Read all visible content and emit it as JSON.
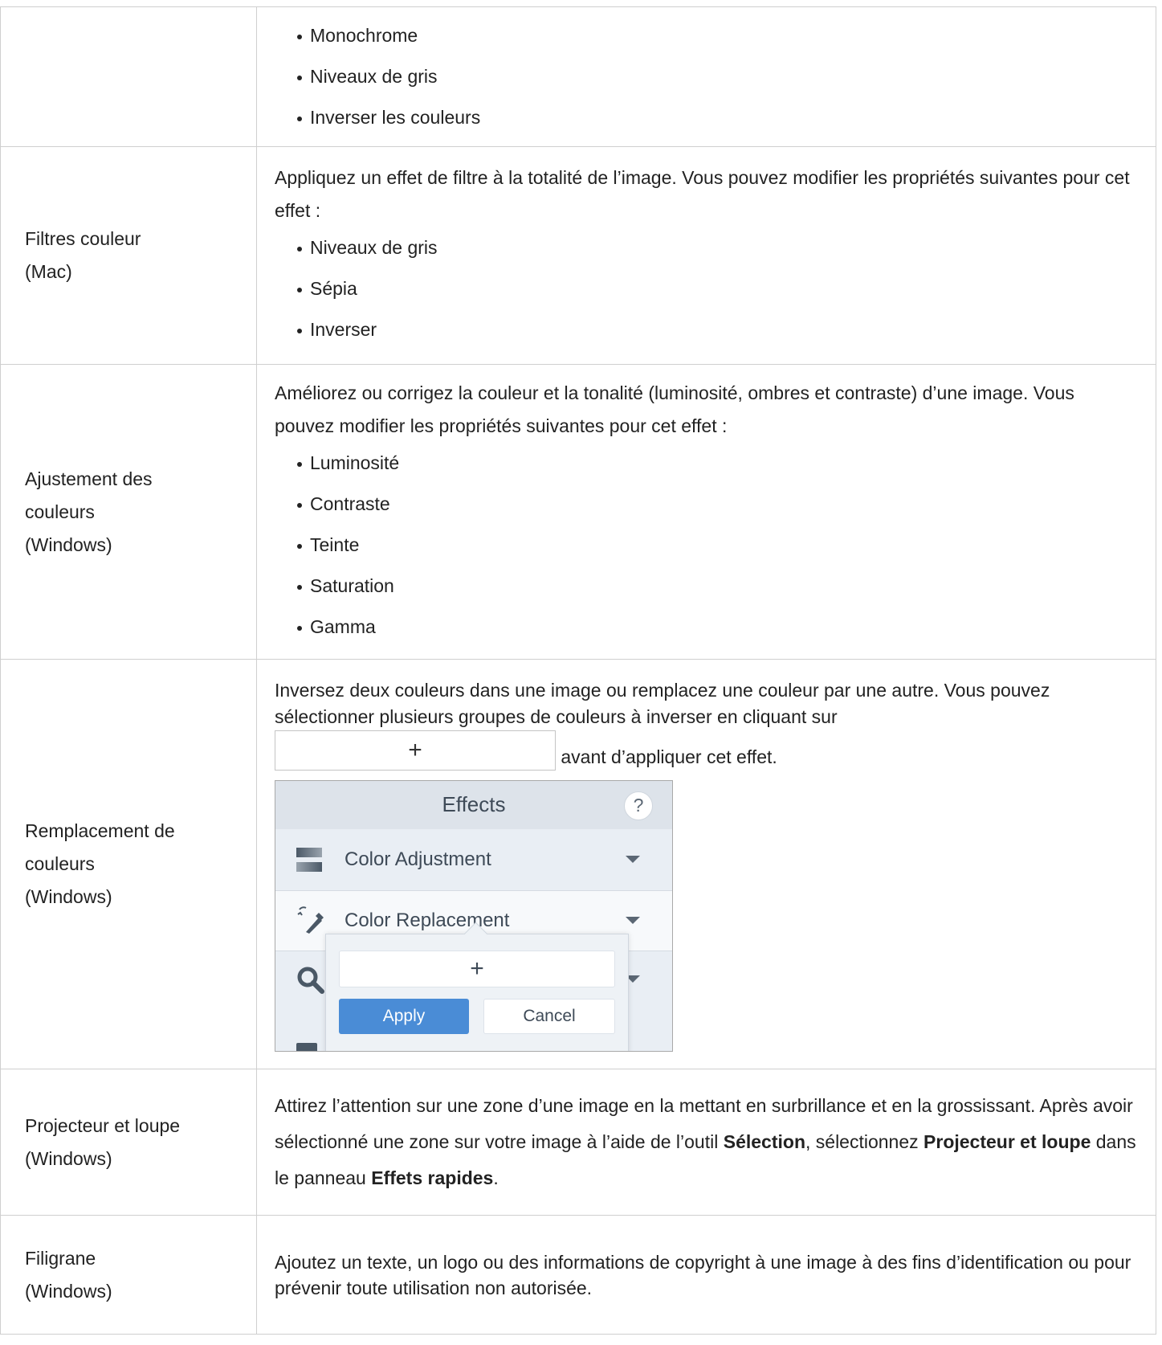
{
  "rows": [
    {
      "name": "",
      "bullets": [
        "Monochrome",
        "Niveaux de gris",
        "Inverser les couleurs"
      ]
    },
    {
      "name_line1": "Filtres couleur",
      "name_line2": "(Mac)",
      "desc": "Appliquez un effet de filtre à la totalité de l’image. Vous pouvez modifier les propriétés suivantes pour cet effet :",
      "bullets": [
        "Niveaux de gris",
        "Sépia",
        "Inverser"
      ]
    },
    {
      "name_line1": "Ajustement des",
      "name_line2": "couleurs",
      "name_line3": "(Windows)",
      "desc": "Améliorez ou corrigez la couleur et la tonalité (luminosité, ombres et contraste) d’une image. Vous pouvez modifier les propriétés suivantes pour cet effet :",
      "bullets": [
        "Luminosité",
        "Contraste",
        "Teinte",
        "Saturation",
        "Gamma"
      ]
    },
    {
      "name_line1": "Remplacement de",
      "name_line2": "couleurs",
      "name_line3": "(Windows)",
      "desc_before": "Inversez deux couleurs dans une image ou remplacez une couleur par une autre. Vous pouvez sélectionner plusieurs groupes de couleurs à inverser en cliquant sur",
      "inline_button": "+",
      "desc_after": "avant d’appliquer cet effet.",
      "panel": {
        "title": "Effects",
        "help": "?",
        "item1": "Color Adjustment",
        "item2": "Color Replacement",
        "popup_plus": "+",
        "apply": "Apply",
        "cancel": "Cancel",
        "accent": "#4a8cd6"
      }
    },
    {
      "name_line1": "Projecteur et loupe",
      "name_line2": "(Windows)",
      "desc_1": "Attirez l’attention sur une zone d’une image en la mettant en surbrillance et en la grossissant. Après avoir sélectionné une zone sur votre image à l’aide de l’outil",
      "bold_1": "Sélection",
      "desc_2": ", sélectionnez",
      "bold_2": "Projecteur et loupe",
      "desc_3": "dans le panneau",
      "bold_3": "Effets rapides",
      "desc_4": "."
    },
    {
      "name_line1": "Filigrane",
      "name_line2": "(Windows)",
      "desc": "Ajoutez un texte, un logo ou des informations de copyright à une image à des fins d’identification ou pour prévenir toute utilisation non autorisée."
    }
  ]
}
